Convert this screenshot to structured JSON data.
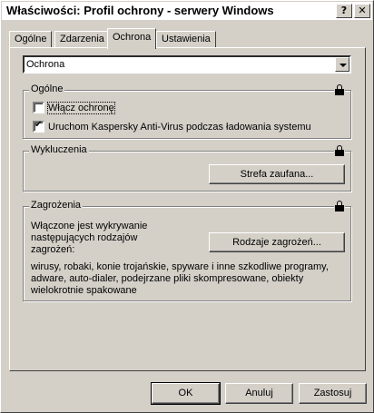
{
  "window": {
    "title": "Właściwości: Profil ochrony - serwery Windows",
    "help_btn": "?",
    "close_btn": "✕"
  },
  "tabs": [
    {
      "label": "Ogólne",
      "active": false
    },
    {
      "label": "Zdarzenia",
      "active": false
    },
    {
      "label": "Ochrona",
      "active": true
    },
    {
      "label": "Ustawienia",
      "active": false
    }
  ],
  "combo": {
    "value": "Ochrona"
  },
  "general": {
    "legend": "Ogólne",
    "enable_protection": {
      "label": "Włącz ochronę",
      "checked": false
    },
    "start_on_boot": {
      "label": "Uruchom Kaspersky Anti-Virus podczas ładowania systemu",
      "checked": true
    }
  },
  "exclusions": {
    "legend": "Wykluczenia",
    "trusted_zone_button": "Strefa zaufana..."
  },
  "threats": {
    "legend": "Zagrożenia",
    "description": "Włączone jest wykrywanie\nnastępujących rodzajów\nzagrożeń:",
    "types_button": "Rodzaje zagrożeń...",
    "list": "wirusy, robaki, konie trojańskie, spyware i inne szkodliwe programy,\nadware, auto-dialer, podejrzane pliki skompresowane, obiekty\nwielokrotnie spakowane"
  },
  "footer": {
    "ok": "OK",
    "cancel": "Anuluj",
    "apply": "Zastosuj"
  }
}
